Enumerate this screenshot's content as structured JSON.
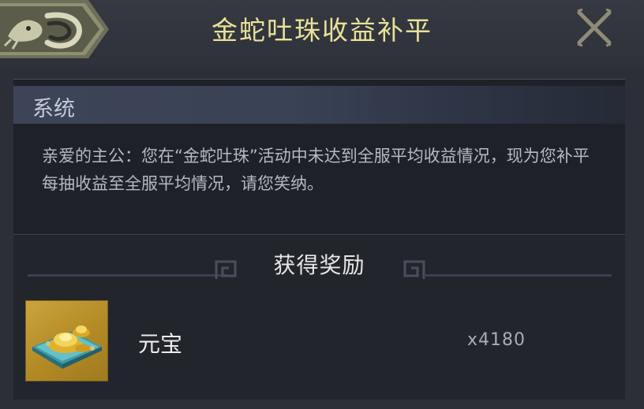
{
  "header": {
    "title": "金蛇吐珠收益补平",
    "back_icon": "dragon-back-icon",
    "close_icon": "close-icon"
  },
  "mail": {
    "sender_label": "系统",
    "message": "亲爱的主公：您在“金蛇吐珠”活动中未达到全服平均收益情况，现为您补平每抽收益至全服平均情况，请您笑纳。"
  },
  "rewards": {
    "title": "获得奖励",
    "items": [
      {
        "name": "元宝",
        "quantity": "x4180",
        "icon": "gold-ingot-icon"
      }
    ]
  },
  "colors": {
    "title": "#e9e29a",
    "background": "#2c2f37",
    "panel": "#1f2128",
    "item_frame": "#cba43a"
  }
}
